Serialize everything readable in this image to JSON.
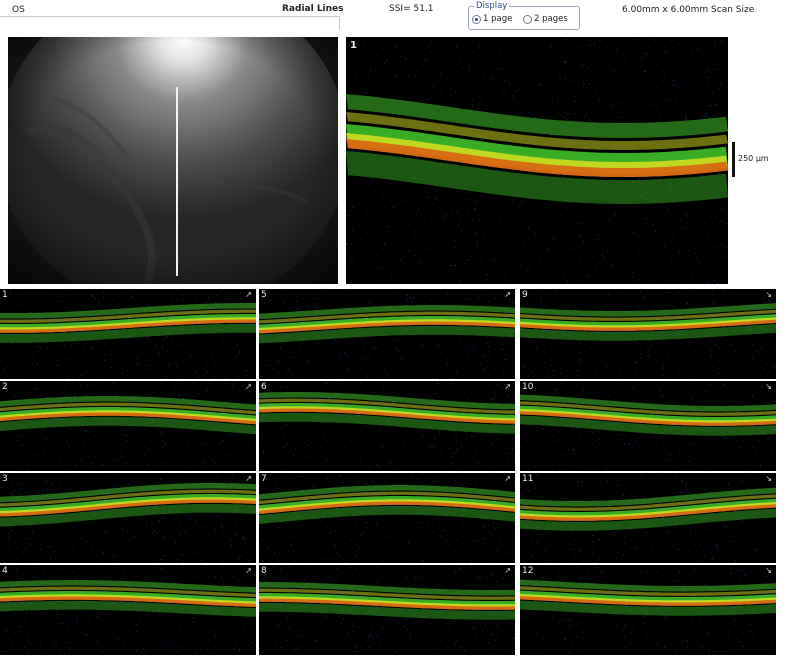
{
  "header": {
    "eye": "OS",
    "scan_type": "Radial Lines",
    "ssi": "SSI= 51.1",
    "scan_size": "6.00mm x 6.00mm Scan Size",
    "display": {
      "legend": "Display",
      "options": [
        {
          "label": "1 page",
          "selected": true
        },
        {
          "label": "2 pages",
          "selected": false
        }
      ]
    }
  },
  "main_scan": {
    "number": "1"
  },
  "scale": {
    "label": "250 µm"
  },
  "thumbnails": [
    {
      "number": "1"
    },
    {
      "number": "2"
    },
    {
      "number": "3"
    },
    {
      "number": "4"
    },
    {
      "number": "5"
    },
    {
      "number": "6"
    },
    {
      "number": "7"
    },
    {
      "number": "8"
    },
    {
      "number": "9"
    },
    {
      "number": "10"
    },
    {
      "number": "11"
    },
    {
      "number": "12"
    }
  ],
  "colors": {
    "retina_green": "#3fbf2a",
    "retina_yellow": "#d8e020",
    "retina_red": "#e04a10",
    "noise_blue": "#1b3f8a"
  }
}
